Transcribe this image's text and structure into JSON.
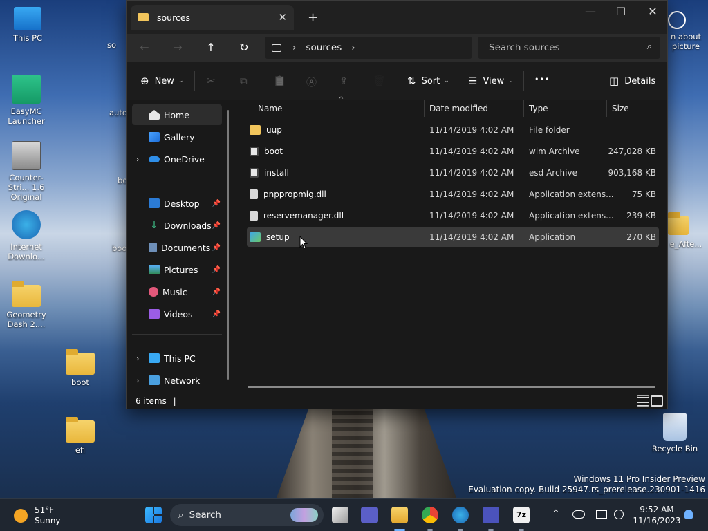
{
  "desktop": {
    "icons_left": [
      {
        "label": "This PC"
      },
      {
        "label": "EasyMC Launcher"
      },
      {
        "label": "Counter-Stri... 1.6 Original"
      },
      {
        "label": "Internet Downlo..."
      },
      {
        "label": "Geometry Dash 2...."
      }
    ],
    "icons_mid": [
      {
        "label": "boot"
      },
      {
        "label": "efi"
      }
    ],
    "partial_left": [
      "so",
      "auto",
      "bo",
      "boo"
    ],
    "right_partial": [
      {
        "label": "n about picture"
      },
      {
        "label": "e_Afte..."
      },
      {
        "label": "Recycle Bin"
      }
    ],
    "watermark": {
      "line1": "Windows 11 Pro Insider Preview",
      "line2": "Evaluation copy. Build 25947.rs_prerelease.230901-1416"
    }
  },
  "explorer": {
    "tab_title": "sources",
    "tab_close": "✕",
    "new_tab": "+",
    "controls": {
      "minimize": "—",
      "maximize": "☐",
      "close": "✕"
    },
    "nav_buttons": {
      "back": "←",
      "forward": "→",
      "up": "↑",
      "refresh": "↻"
    },
    "address": {
      "chev1": "›",
      "folder": "sources",
      "chev2": "›"
    },
    "search": {
      "placeholder": "Search sources",
      "icon": "⌕"
    },
    "commands": {
      "new": "New",
      "new_icon": "⊕",
      "cut": "✂",
      "copy": "⧉",
      "paste": "📋",
      "rename": "Ⓐ",
      "share": "⇪",
      "delete": "🗑",
      "sort": "Sort",
      "sort_icon": "⇅",
      "view": "View",
      "view_icon": "☰",
      "more": "•••",
      "details": "Details",
      "details_icon": "◫",
      "dropdown": "⌄"
    },
    "nav": {
      "home": "Home",
      "gallery": "Gallery",
      "onedrive": "OneDrive",
      "quick": [
        "Desktop",
        "Downloads",
        "Documents",
        "Pictures",
        "Music",
        "Videos"
      ],
      "this_pc": "This PC",
      "network": "Network",
      "pin": "📌",
      "expand": "›"
    },
    "columns": {
      "name": "Name",
      "date": "Date modified",
      "type": "Type",
      "size": "Size",
      "sort_arrow": "^"
    },
    "files": [
      {
        "name": "uup",
        "date": "11/14/2019 4:02 AM",
        "type": "File folder",
        "size": "",
        "kind": "folder"
      },
      {
        "name": "boot",
        "date": "11/14/2019 4:02 AM",
        "type": "wim Archive",
        "size": "247,028 KB",
        "kind": "archive"
      },
      {
        "name": "install",
        "date": "11/14/2019 4:02 AM",
        "type": "esd Archive",
        "size": "903,168 KB",
        "kind": "archive"
      },
      {
        "name": "pnppropmig.dll",
        "date": "11/14/2019 4:02 AM",
        "type": "Application extens...",
        "size": "75 KB",
        "kind": "dll"
      },
      {
        "name": "reservemanager.dll",
        "date": "11/14/2019 4:02 AM",
        "type": "Application extens...",
        "size": "239 KB",
        "kind": "dll"
      },
      {
        "name": "setup",
        "date": "11/14/2019 4:02 AM",
        "type": "Application",
        "size": "270 KB",
        "kind": "app"
      }
    ],
    "status": "6 items",
    "status_cursor": "|"
  },
  "taskbar": {
    "temp": "51°F",
    "condition": "Sunny",
    "search_label": "Search",
    "search_icon": "⌕",
    "tray_chevron": "⌃",
    "time": "9:52 AM",
    "date": "11/16/2023"
  }
}
